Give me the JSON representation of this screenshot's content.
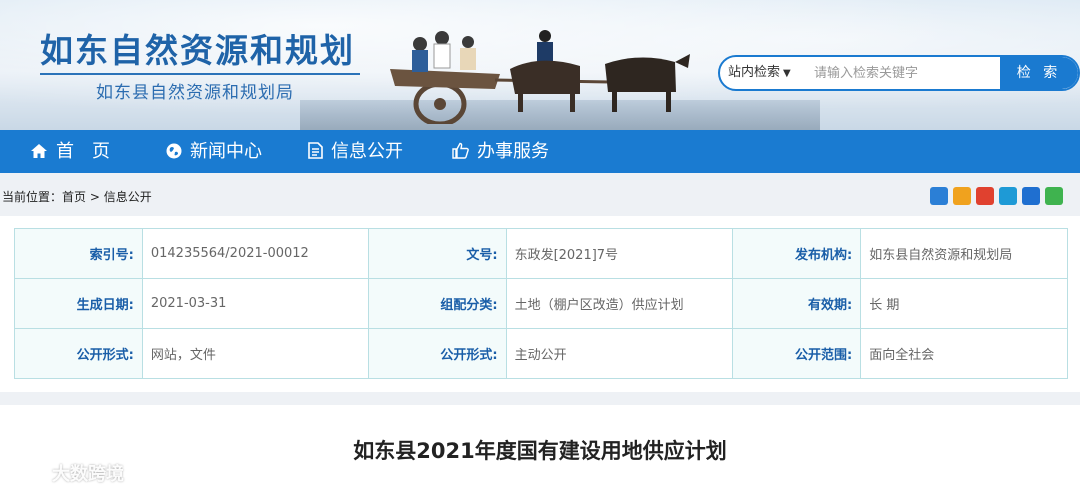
{
  "header": {
    "logo_title": "如东自然资源和规划",
    "logo_subtitle": "如东县自然资源和规划局"
  },
  "search": {
    "scope_label": "站内检索",
    "placeholder": "请输入检索关键字",
    "button_label": "检 索"
  },
  "nav": {
    "items": [
      {
        "label": "首　页",
        "icon": "home-icon"
      },
      {
        "label": "新闻中心",
        "icon": "globe-icon"
      },
      {
        "label": "信息公开",
        "icon": "document-icon"
      },
      {
        "label": "办事服务",
        "icon": "thumbs-up-icon"
      }
    ]
  },
  "breadcrumb": {
    "prefix": "当前位置：",
    "home": "首页",
    "separator": " > ",
    "current": "信息公开"
  },
  "share": {
    "icons": [
      "plus-share-icon",
      "qzone-icon",
      "weibo-icon",
      "tencent-weibo-icon",
      "renren-icon",
      "wechat-icon"
    ],
    "colors": [
      "#2b7fd6",
      "#f0a21e",
      "#e0412f",
      "#1e9ad6",
      "#1f6fd0",
      "#3fb34f"
    ]
  },
  "meta": {
    "rows": [
      [
        {
          "label": "索引号:",
          "value": "014235564/2021-00012"
        },
        {
          "label": "文号:",
          "value": "东政发[2021]7号"
        },
        {
          "label": "发布机构:",
          "value": "如东县自然资源和规划局"
        }
      ],
      [
        {
          "label": "生成日期:",
          "value": "2021-03-31"
        },
        {
          "label": "组配分类:",
          "value": "土地（棚户区改造）供应计划"
        },
        {
          "label": "有效期:",
          "value": "长 期"
        }
      ],
      [
        {
          "label": "公开形式:",
          "value": "网站，文件"
        },
        {
          "label": "公开形式:",
          "value": "主动公开"
        },
        {
          "label": "公开范围:",
          "value": "面向全社会"
        }
      ]
    ]
  },
  "article": {
    "title": "如东县2021年度国有建设用地供应计划"
  },
  "watermark": {
    "text": "大数跨境"
  }
}
